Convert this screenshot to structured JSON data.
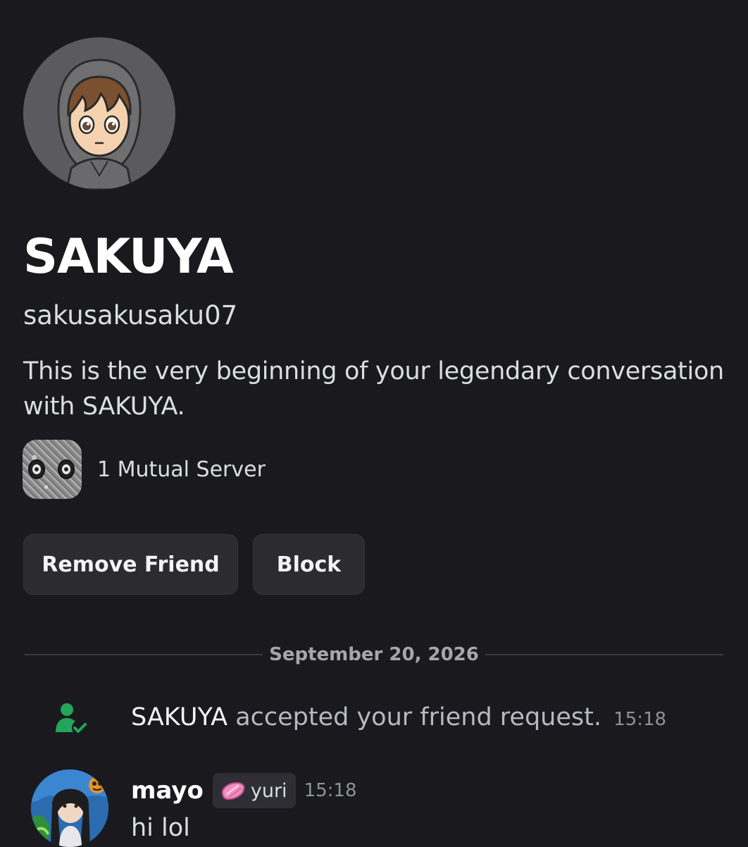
{
  "profile": {
    "display_name": "SAKUYA",
    "username": "sakusakusaku07",
    "intro": "This is the very beginning of your legendary conversation with SAKUYA.",
    "mutual_servers_label": "1 Mutual Server"
  },
  "actions": {
    "remove_friend_label": "Remove Friend",
    "block_label": "Block"
  },
  "conversation": {
    "date_divider": "September 20, 2026",
    "system_message": {
      "icon": "friend-accepted-icon",
      "actor": "SAKUYA",
      "text": "accepted your friend request.",
      "time": "15:18"
    },
    "messages": [
      {
        "author": "mayo",
        "tag": {
          "label": "yuri",
          "icon": "pink-gem-icon"
        },
        "time": "15:18",
        "content": "hi lol"
      }
    ]
  },
  "colors": {
    "background": "#1a1a1e",
    "button_background": "#2b2b30",
    "online_green": "#23a55a",
    "muted_text": "#8e9297"
  }
}
